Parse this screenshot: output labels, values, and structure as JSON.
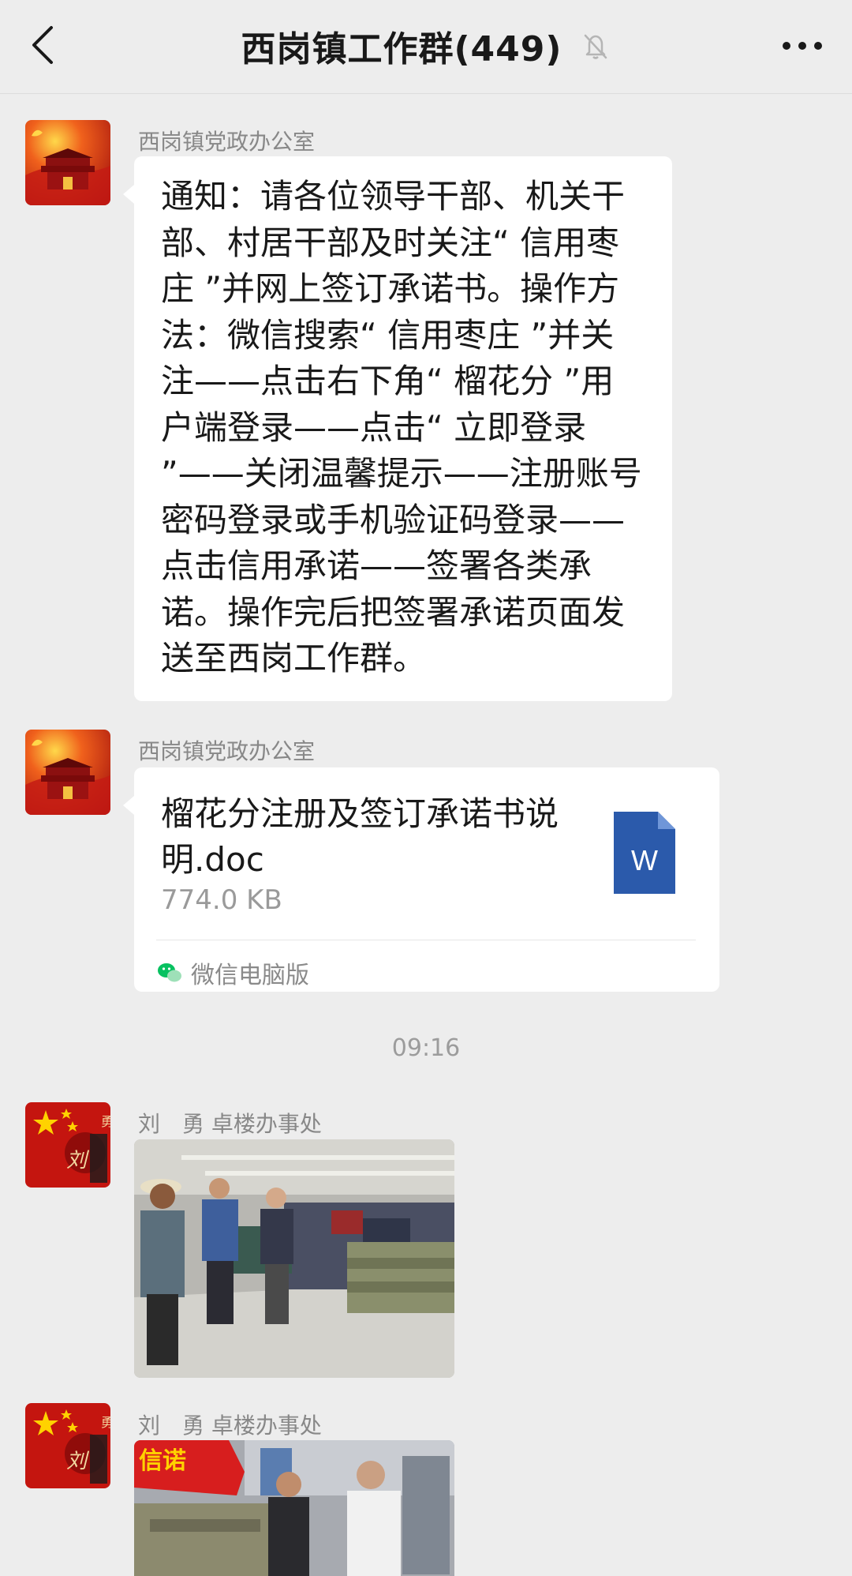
{
  "header": {
    "title": "西岗镇工作群(449)",
    "icons": [
      "back-arrow-icon",
      "mute-bell-icon",
      "more-dots-icon"
    ]
  },
  "messages": [
    {
      "sender": "西岗镇党政办公室",
      "type": "text",
      "text": "通知：请各位领导干部、机关干部、村居干部及时关注“ 信用枣庄 ”并网上签订承诺书。操作方法：微信搜索“ 信用枣庄 ”并关注——点击右下角“ 榴花分 ”用户端登录——点击“ 立即登录 ”——关闭温馨提示——注册账号密码登录或手机验证码登录——点击信用承诺——签署各类承诺。操作完后把签署承诺页面发送至西岗工作群。"
    },
    {
      "sender": "西岗镇党政办公室",
      "type": "file",
      "file_name": "榴花分注册及签订承诺书说明.doc",
      "file_size": "774.0 KB",
      "file_icon_letter": "W",
      "source": "微信电脑版"
    },
    {
      "type": "time",
      "time": "09:16"
    },
    {
      "sender": "刘　勇 卓楼办事处",
      "type": "image",
      "description": "photo-factory-inspection-1"
    },
    {
      "sender": "刘　勇 卓楼办事处",
      "type": "image",
      "description": "photo-factory-inspection-2",
      "banner_text": "信诺"
    }
  ],
  "colors": {
    "background": "#ededed",
    "bubble": "#ffffff",
    "word_blue": "#2b5aab",
    "wechat_green": "#07c160"
  }
}
